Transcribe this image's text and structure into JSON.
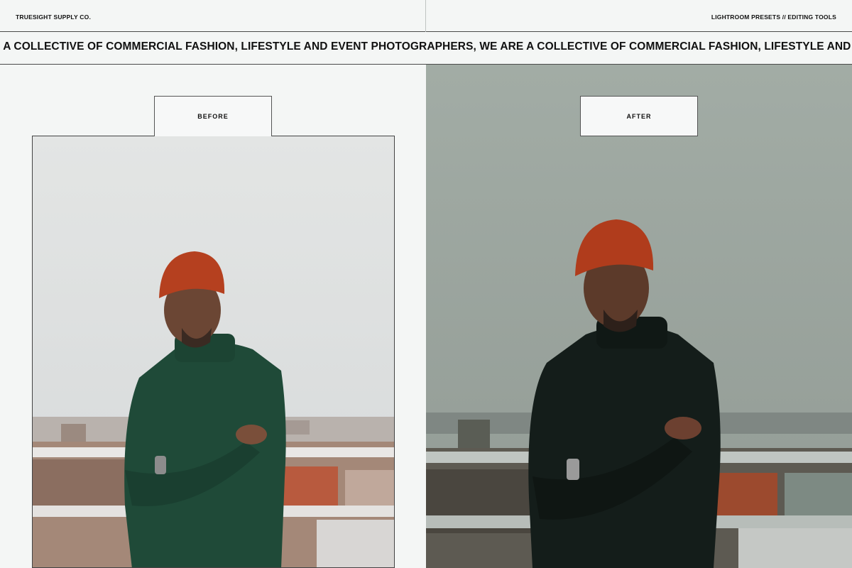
{
  "header": {
    "brand": "TRUESIGHT SUPPLY CO.",
    "tools": "LIGHTROOM PRESETS // EDITING TOOLS"
  },
  "ticker": {
    "text": "E A COLLECTIVE OF COMMERCIAL FASHION, LIFESTYLE AND EVENT PHOTOGRAPHERS, WE ARE A COLLECTIVE OF COMMERCIAL FASHION, LIFESTYLE AND EVENT PHOTOGRAPHERS"
  },
  "panels": {
    "before_label": "BEFORE",
    "after_label": "AFTER"
  },
  "colors": {
    "before_sky": "#dfe1e1",
    "after_sky": "#9ba59e",
    "beanie": "#b5401f",
    "sweater_before": "#1f4a38",
    "sweater_after": "#141d1a"
  }
}
